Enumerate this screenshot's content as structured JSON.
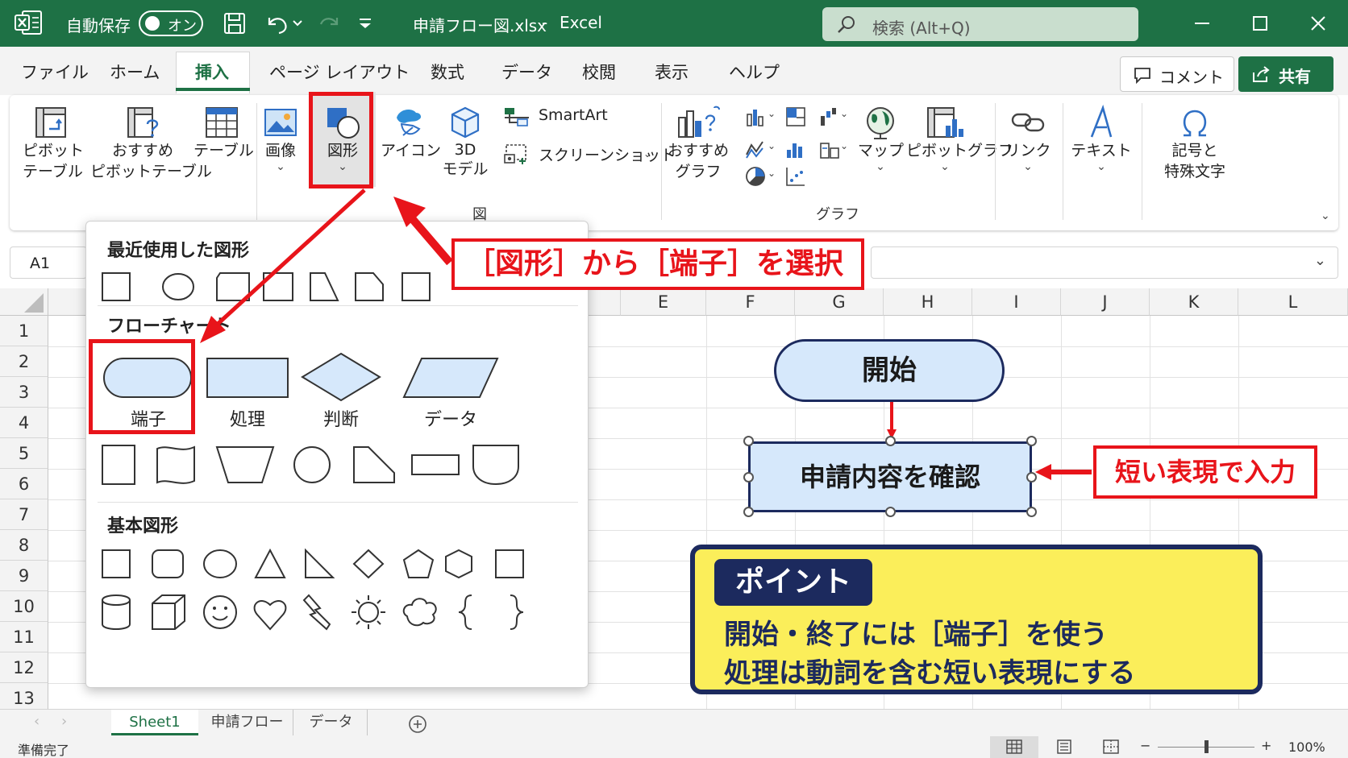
{
  "titlebar": {
    "autosave_label": "自動保存",
    "autosave_state": "オン",
    "filename": "申請フロー図.xlsx",
    "separator": "-",
    "app_name": "Excel",
    "search_placeholder": "検索 (Alt+Q)"
  },
  "menu": {
    "tabs": [
      "ファイル",
      "ホーム",
      "挿入",
      "ページ レイアウト",
      "数式",
      "データ",
      "校閲",
      "表示",
      "ヘルプ"
    ],
    "active_tab": "挿入",
    "comment_button": "コメント",
    "share_button": "共有"
  },
  "ribbon": {
    "pivot_table": [
      "ピボット",
      "テーブル"
    ],
    "recommended_pivot": [
      "おすすめ",
      "ピボットテーブル"
    ],
    "table": "テーブル",
    "image": "画像",
    "shapes": "図形",
    "icons": "アイコン",
    "model3d": [
      "3D",
      "モデル"
    ],
    "smartart": "SmartArt",
    "screenshot": "スクリーンショット",
    "group_illustrations": "図",
    "recommended_chart": [
      "おすすめ",
      "グラフ"
    ],
    "map": "マップ",
    "pivot_chart": "ピボットグラフ",
    "group_charts": "グラフ",
    "link": "リンク",
    "text": "テキスト",
    "symbols": [
      "記号と",
      "特殊文字"
    ]
  },
  "formula_bar": {
    "name_box": "A1"
  },
  "grid": {
    "columns": [
      "E",
      "F",
      "G",
      "H",
      "I",
      "J",
      "K",
      "L"
    ],
    "rows": [
      "1",
      "2",
      "3",
      "4",
      "5",
      "6",
      "7",
      "8",
      "9",
      "10",
      "11",
      "12",
      "13"
    ]
  },
  "shapes_menu": {
    "recent_heading": "最近使用した図形",
    "flowchart_heading": "フローチャート",
    "flowchart_labels": [
      "端子",
      "処理",
      "判断",
      "データ"
    ],
    "basic_heading": "基本図形"
  },
  "annotations": {
    "select_callout": "［図形］から［端子］を選択",
    "short_callout": "短い表現で入力",
    "point_badge": "ポイント",
    "point_line1": "開始・終了には［端子］を使う",
    "point_line2": "処理は動詞を含む短い表現にする"
  },
  "flowchart": {
    "start": "開始",
    "process": "申請内容を確認"
  },
  "sheets": {
    "tabs": [
      "Sheet1",
      "申請フロー",
      "データ"
    ],
    "active": "Sheet1"
  },
  "status": {
    "ready": "準備完了",
    "zoom": "100%"
  },
  "colors": {
    "excel_green": "#1e7145",
    "callout_red": "#e8141a",
    "shape_fill": "#d6e8fb",
    "navy": "#1c2a5e",
    "point_yellow": "#fbee5a"
  }
}
